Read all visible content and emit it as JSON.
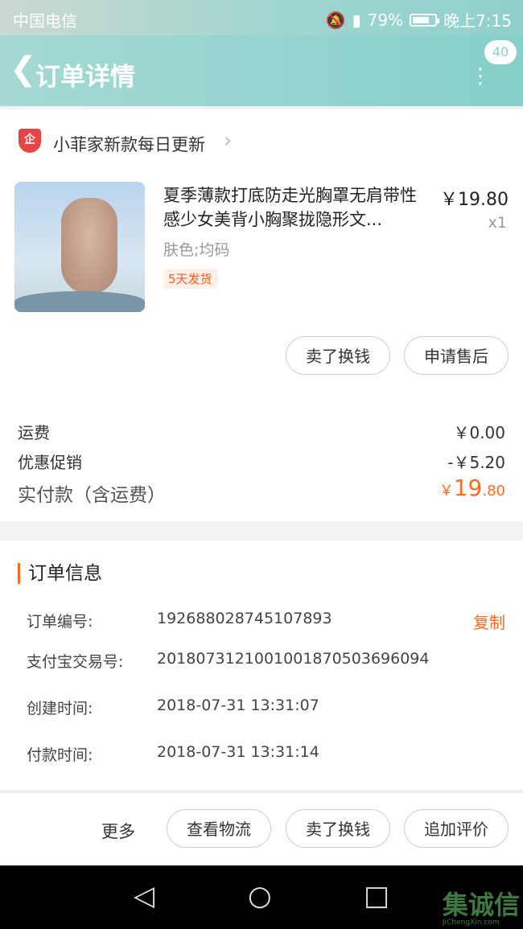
{
  "status_bar": {
    "carrier": "中国电信",
    "battery_percent": "79%",
    "time": "晚上7:15"
  },
  "nav": {
    "title": "订单详情",
    "badge_count": "40"
  },
  "shop": {
    "badge_text": "企",
    "name": "小菲家新款每日更新"
  },
  "item": {
    "title": "夏季薄款打底防走光胸罩无肩带性感少女美背小胸聚拢隐形文...",
    "price": "￥19.80",
    "qty": "x1",
    "spec": "肤色;均码",
    "ship_tag": "5天发货"
  },
  "item_actions": {
    "sell_exchange": "卖了换钱",
    "after_sale": "申请售后"
  },
  "summary": {
    "shipping_label": "运费",
    "shipping_value": "￥0.00",
    "discount_label": "优惠促销",
    "discount_value": "-￥5.20",
    "paid_label": "实付款（含运费）",
    "paid_currency": "￥",
    "paid_integer": "19",
    "paid_decimal": ".80"
  },
  "order_info": {
    "title": "订单信息",
    "order_no_label": "订单编号:",
    "order_no": "192688028745107893",
    "copy": "复制",
    "alipay_label": "支付宝交易号:",
    "alipay_no": "2018073121001001870503696094",
    "created_label": "创建时间:",
    "created": "2018-07-31 13:31:07",
    "paid_label": "付款时间:",
    "paid": "2018-07-31 13:31:14"
  },
  "bottom_bar": {
    "more": "更多",
    "logistics": "查看物流",
    "sell_exchange": "卖了换钱",
    "add_review": "追加评价"
  },
  "watermark": {
    "brand": "集诚信",
    "url": "JiChengXin.com"
  },
  "colors": {
    "accent": "#ff6a1f",
    "header": "#8fd0cc"
  }
}
